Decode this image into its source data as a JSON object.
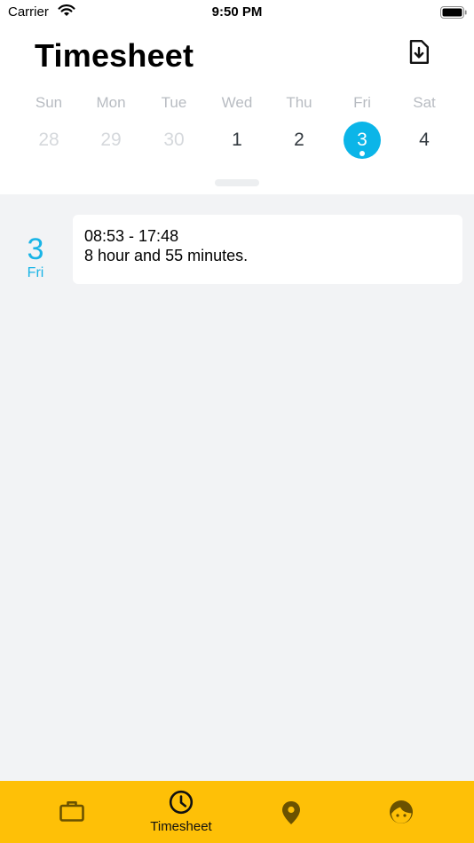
{
  "status_bar": {
    "carrier": "Carrier",
    "time": "9:50 PM"
  },
  "header": {
    "title": "Timesheet",
    "export_icon": "file-download-icon"
  },
  "week": {
    "days": [
      {
        "name": "Sun",
        "num": "28",
        "state": "muted"
      },
      {
        "name": "Mon",
        "num": "29",
        "state": "muted"
      },
      {
        "name": "Tue",
        "num": "30",
        "state": "muted"
      },
      {
        "name": "Wed",
        "num": "1",
        "state": "normal"
      },
      {
        "name": "Thu",
        "num": "2",
        "state": "normal"
      },
      {
        "name": "Fri",
        "num": "3",
        "state": "selected"
      },
      {
        "name": "Sat",
        "num": "4",
        "state": "normal"
      }
    ]
  },
  "entries": [
    {
      "day_num": "3",
      "day_name": "Fri",
      "range": "08:53 - 17:48",
      "duration": "8 hour and 55 minutes."
    }
  ],
  "tabbar": {
    "tabs": [
      {
        "icon": "briefcase-icon",
        "label": ""
      },
      {
        "icon": "clock-icon",
        "label": "Timesheet"
      },
      {
        "icon": "location-pin-icon",
        "label": ""
      },
      {
        "icon": "profile-face-icon",
        "label": ""
      }
    ]
  },
  "colors": {
    "accent": "#0bb5e8",
    "tabbar": "#fec007",
    "background": "#f2f3f5"
  }
}
